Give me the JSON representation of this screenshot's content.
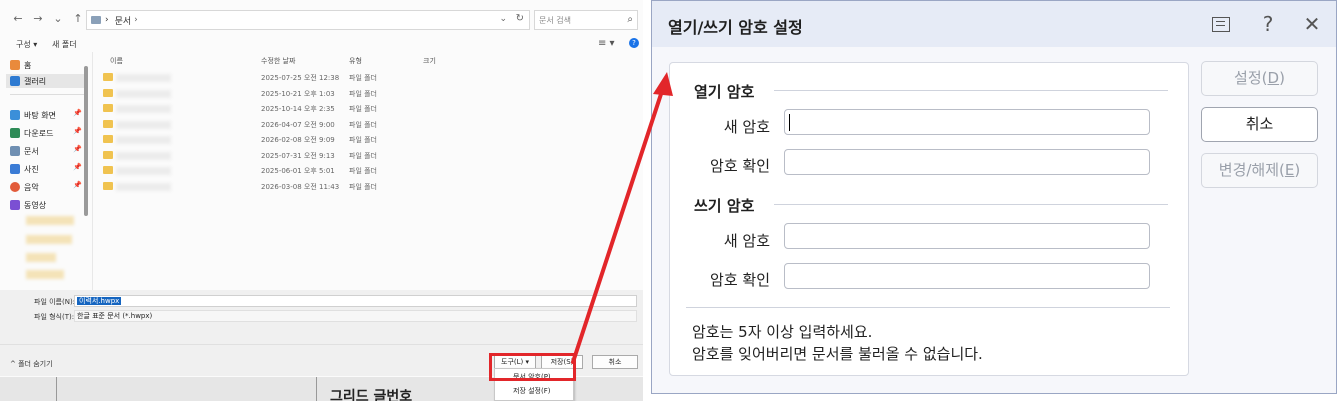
{
  "save_dialog": {
    "nav": {
      "back": "←",
      "forward": "→",
      "recent": "⌄",
      "up": "↑"
    },
    "address": {
      "path_sep": "›",
      "folder": "문서",
      "dropdown": "⌄",
      "refresh": "↻"
    },
    "search": {
      "placeholder": "문서 검색",
      "icon": "⌕"
    },
    "toolbar": {
      "organize": "구성 ▾",
      "new_folder": "새 폴더",
      "view": "≡ ▾",
      "help": "?"
    },
    "sidebar": {
      "items": [
        {
          "label": "홈",
          "icon": "home-icon",
          "color": "#e98a3c",
          "pinned": false
        },
        {
          "label": "갤러리",
          "icon": "gallery-icon",
          "color": "#2e7ad1",
          "pinned": false,
          "selected": true
        },
        {
          "label": "바탕 화면",
          "icon": "desktop-icon",
          "color": "#3b8fd9",
          "pinned": true
        },
        {
          "label": "다운로드",
          "icon": "download-icon",
          "color": "#2e8b57",
          "pinned": true
        },
        {
          "label": "문서",
          "icon": "document-icon",
          "color": "#6f8fb2",
          "pinned": true
        },
        {
          "label": "사진",
          "icon": "pictures-icon",
          "color": "#3a7bd5",
          "pinned": true
        },
        {
          "label": "음악",
          "icon": "music-icon",
          "color": "#e25b3a",
          "pinned": true
        },
        {
          "label": "동영상",
          "icon": "video-icon",
          "color": "#7b4fd3",
          "pinned": true
        }
      ],
      "pin_glyph": "📌"
    },
    "columns": {
      "name": "이름",
      "modified": "수정한 날짜",
      "type": "유형",
      "size": "크기"
    },
    "files": [
      {
        "modified": "2025-07-25 오전 12:38",
        "type": "파일 폴더"
      },
      {
        "modified": "2025-10-21 오후 1:03",
        "type": "파일 폴더"
      },
      {
        "modified": "2025-10-14 오후 2:35",
        "type": "파일 폴더"
      },
      {
        "modified": "2026-04-07 오전 9:00",
        "type": "파일 폴더"
      },
      {
        "modified": "2026-02-08 오전 9:09",
        "type": "파일 폴더"
      },
      {
        "modified": "2025-07-31 오전 9:13",
        "type": "파일 폴더"
      },
      {
        "modified": "2025-06-01 오후 5:01",
        "type": "파일 폴더"
      },
      {
        "modified": "2026-03-08 오전 11:43",
        "type": "파일 폴더"
      }
    ],
    "filename_label": "파일 이름(N):",
    "filename_value": "이력서.hwpx",
    "filetype_label": "파일 형식(T):",
    "filetype_value": "한글 표준 문서 (*.hwpx)",
    "hide_folders": "^ 폴더 숨기기",
    "buttons": {
      "tools": "도구(L) ▾",
      "save": "저장(S)",
      "cancel": "취소"
    },
    "tools_menu": {
      "item1": "문서 암호(P)",
      "item2": "저장 설정(F)"
    },
    "behind_text": "그리드 글번호"
  },
  "password_dialog": {
    "title": "열기/쓰기 암호 설정",
    "header_icons": {
      "help": "?",
      "close": "✕"
    },
    "open_section": {
      "title": "열기 암호",
      "new_label": "새 암호",
      "confirm_label": "암호 확인",
      "new_value": "",
      "confirm_value": ""
    },
    "write_section": {
      "title": "쓰기 암호",
      "new_label": "새 암호",
      "confirm_label": "암호 확인",
      "new_value": "",
      "confirm_value": ""
    },
    "note_line1": "암호는 5자 이상 입력하세요.",
    "note_line2": "암호를 잊어버리면 문서를 불러올 수 없습니다.",
    "buttons": {
      "set": {
        "label": "설정",
        "key": "D",
        "enabled": false
      },
      "cancel": {
        "label": "취소",
        "enabled": true
      },
      "change": {
        "label": "변경/해제",
        "key": "E",
        "enabled": false
      }
    }
  },
  "colors": {
    "highlight": "#e2262a",
    "selection": "#1565c0",
    "dialog_header": "#e6ebf6"
  }
}
